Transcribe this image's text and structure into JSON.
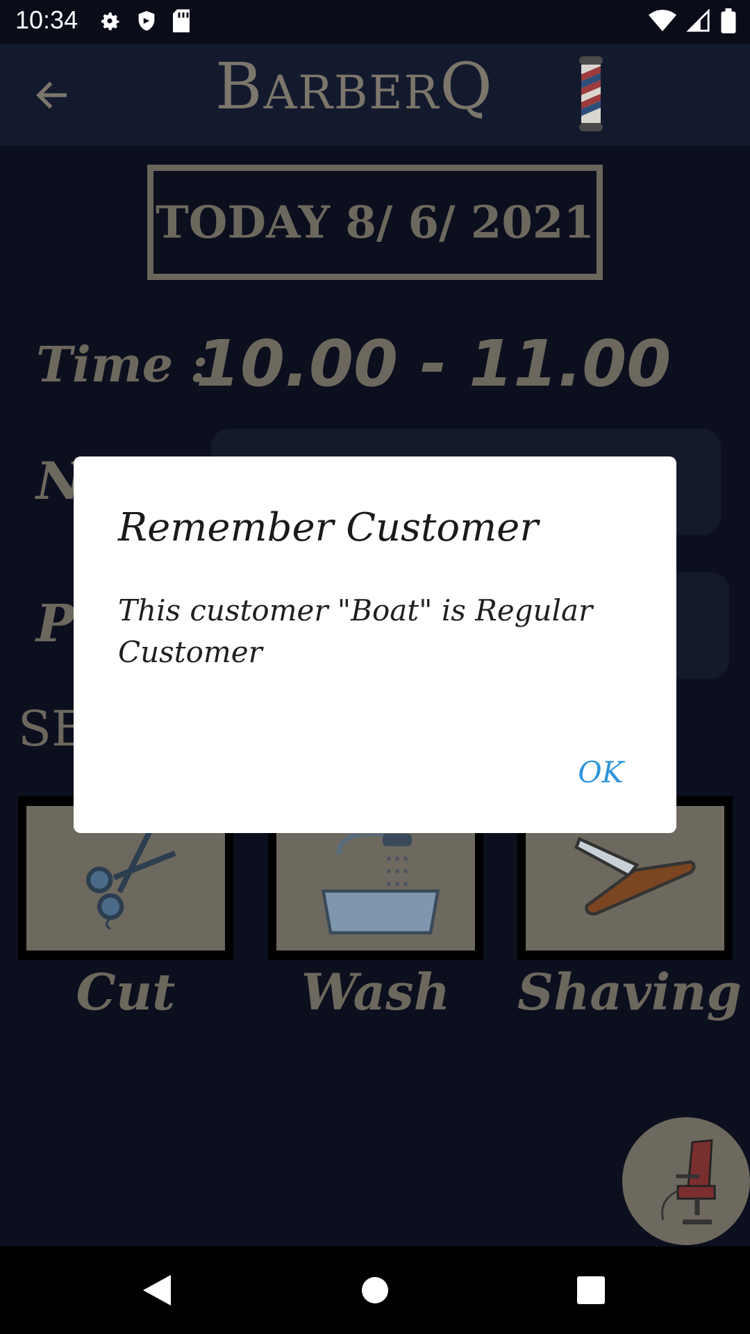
{
  "status_bar": {
    "time": "10:34",
    "left_icons": [
      "gear-icon",
      "shield-icon",
      "sd-card-icon"
    ],
    "right_icons": [
      "wifi-icon",
      "signal-icon",
      "battery-icon"
    ]
  },
  "app_bar": {
    "title_cap": "B",
    "title_rest": "ARBER",
    "title_q": "Q",
    "back_icon": "arrow-left-icon",
    "logo_icon": "barber-pole-icon"
  },
  "booking": {
    "date_text": "TODAY 8/ 6/ 2021",
    "time_label": "Time :",
    "time_value": "10.00 - 11.00",
    "name_label_partial": "N",
    "phone_label_partial": "Pl",
    "service_label_partial": "SE"
  },
  "services": [
    {
      "name": "Cut",
      "icon": "scissors-icon"
    },
    {
      "name": "Wash",
      "icon": "shower-icon"
    },
    {
      "name": "Shaving",
      "icon": "razor-icon"
    }
  ],
  "fab": {
    "icon": "barber-chair-icon"
  },
  "dialog": {
    "title": "Remember Customer",
    "message": "This customer \"Boat\" is Regular Customer",
    "ok_label": "OK"
  },
  "nav_bar": {
    "icons": [
      "back-triangle-icon",
      "home-circle-icon",
      "recents-square-icon"
    ]
  },
  "colors": {
    "background": "#0c0f1e",
    "app_bar": "#141a2e",
    "muted_text": "#6d685d",
    "dialog_accent": "#2f95dc"
  }
}
